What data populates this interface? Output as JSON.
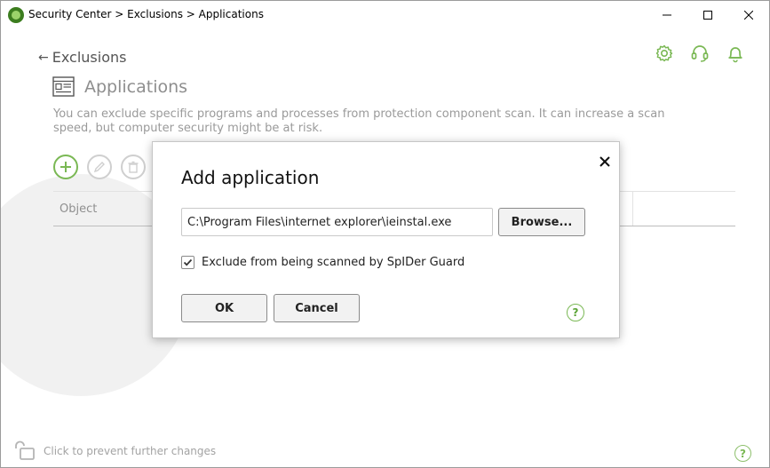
{
  "window": {
    "title": "Security Center > Exclusions > Applications"
  },
  "header": {
    "back_label": "Exclusions",
    "page_title": "Applications",
    "description": "You can exclude specific programs and processes from protection component scan. It can increase a scan speed, but computer security might be at risk."
  },
  "icons": {
    "app": "dr-web-spider-icon",
    "settings": "gear-icon",
    "support": "headset-icon",
    "notifications": "bell-icon",
    "add": "plus-icon",
    "edit": "pencil-icon",
    "delete": "trash-icon",
    "lock": "unlocked-padlock-icon",
    "help": "question-mark-icon"
  },
  "table": {
    "columns": [
      "Object"
    ]
  },
  "footer": {
    "lock_text": "Click to prevent further changes",
    "help_glyph": "?"
  },
  "dialog": {
    "title": "Add application",
    "path_value": "C:\\Program Files\\internet explorer\\ieinstal.exe",
    "browse_label": "Browse...",
    "checkbox_label": "Exclude from being scanned by SpIDer Guard",
    "checkbox_checked": true,
    "ok_label": "OK",
    "cancel_label": "Cancel",
    "help_glyph": "?"
  },
  "colors": {
    "accent_green": "#7ab854",
    "muted_text": "#9a9a9a"
  }
}
